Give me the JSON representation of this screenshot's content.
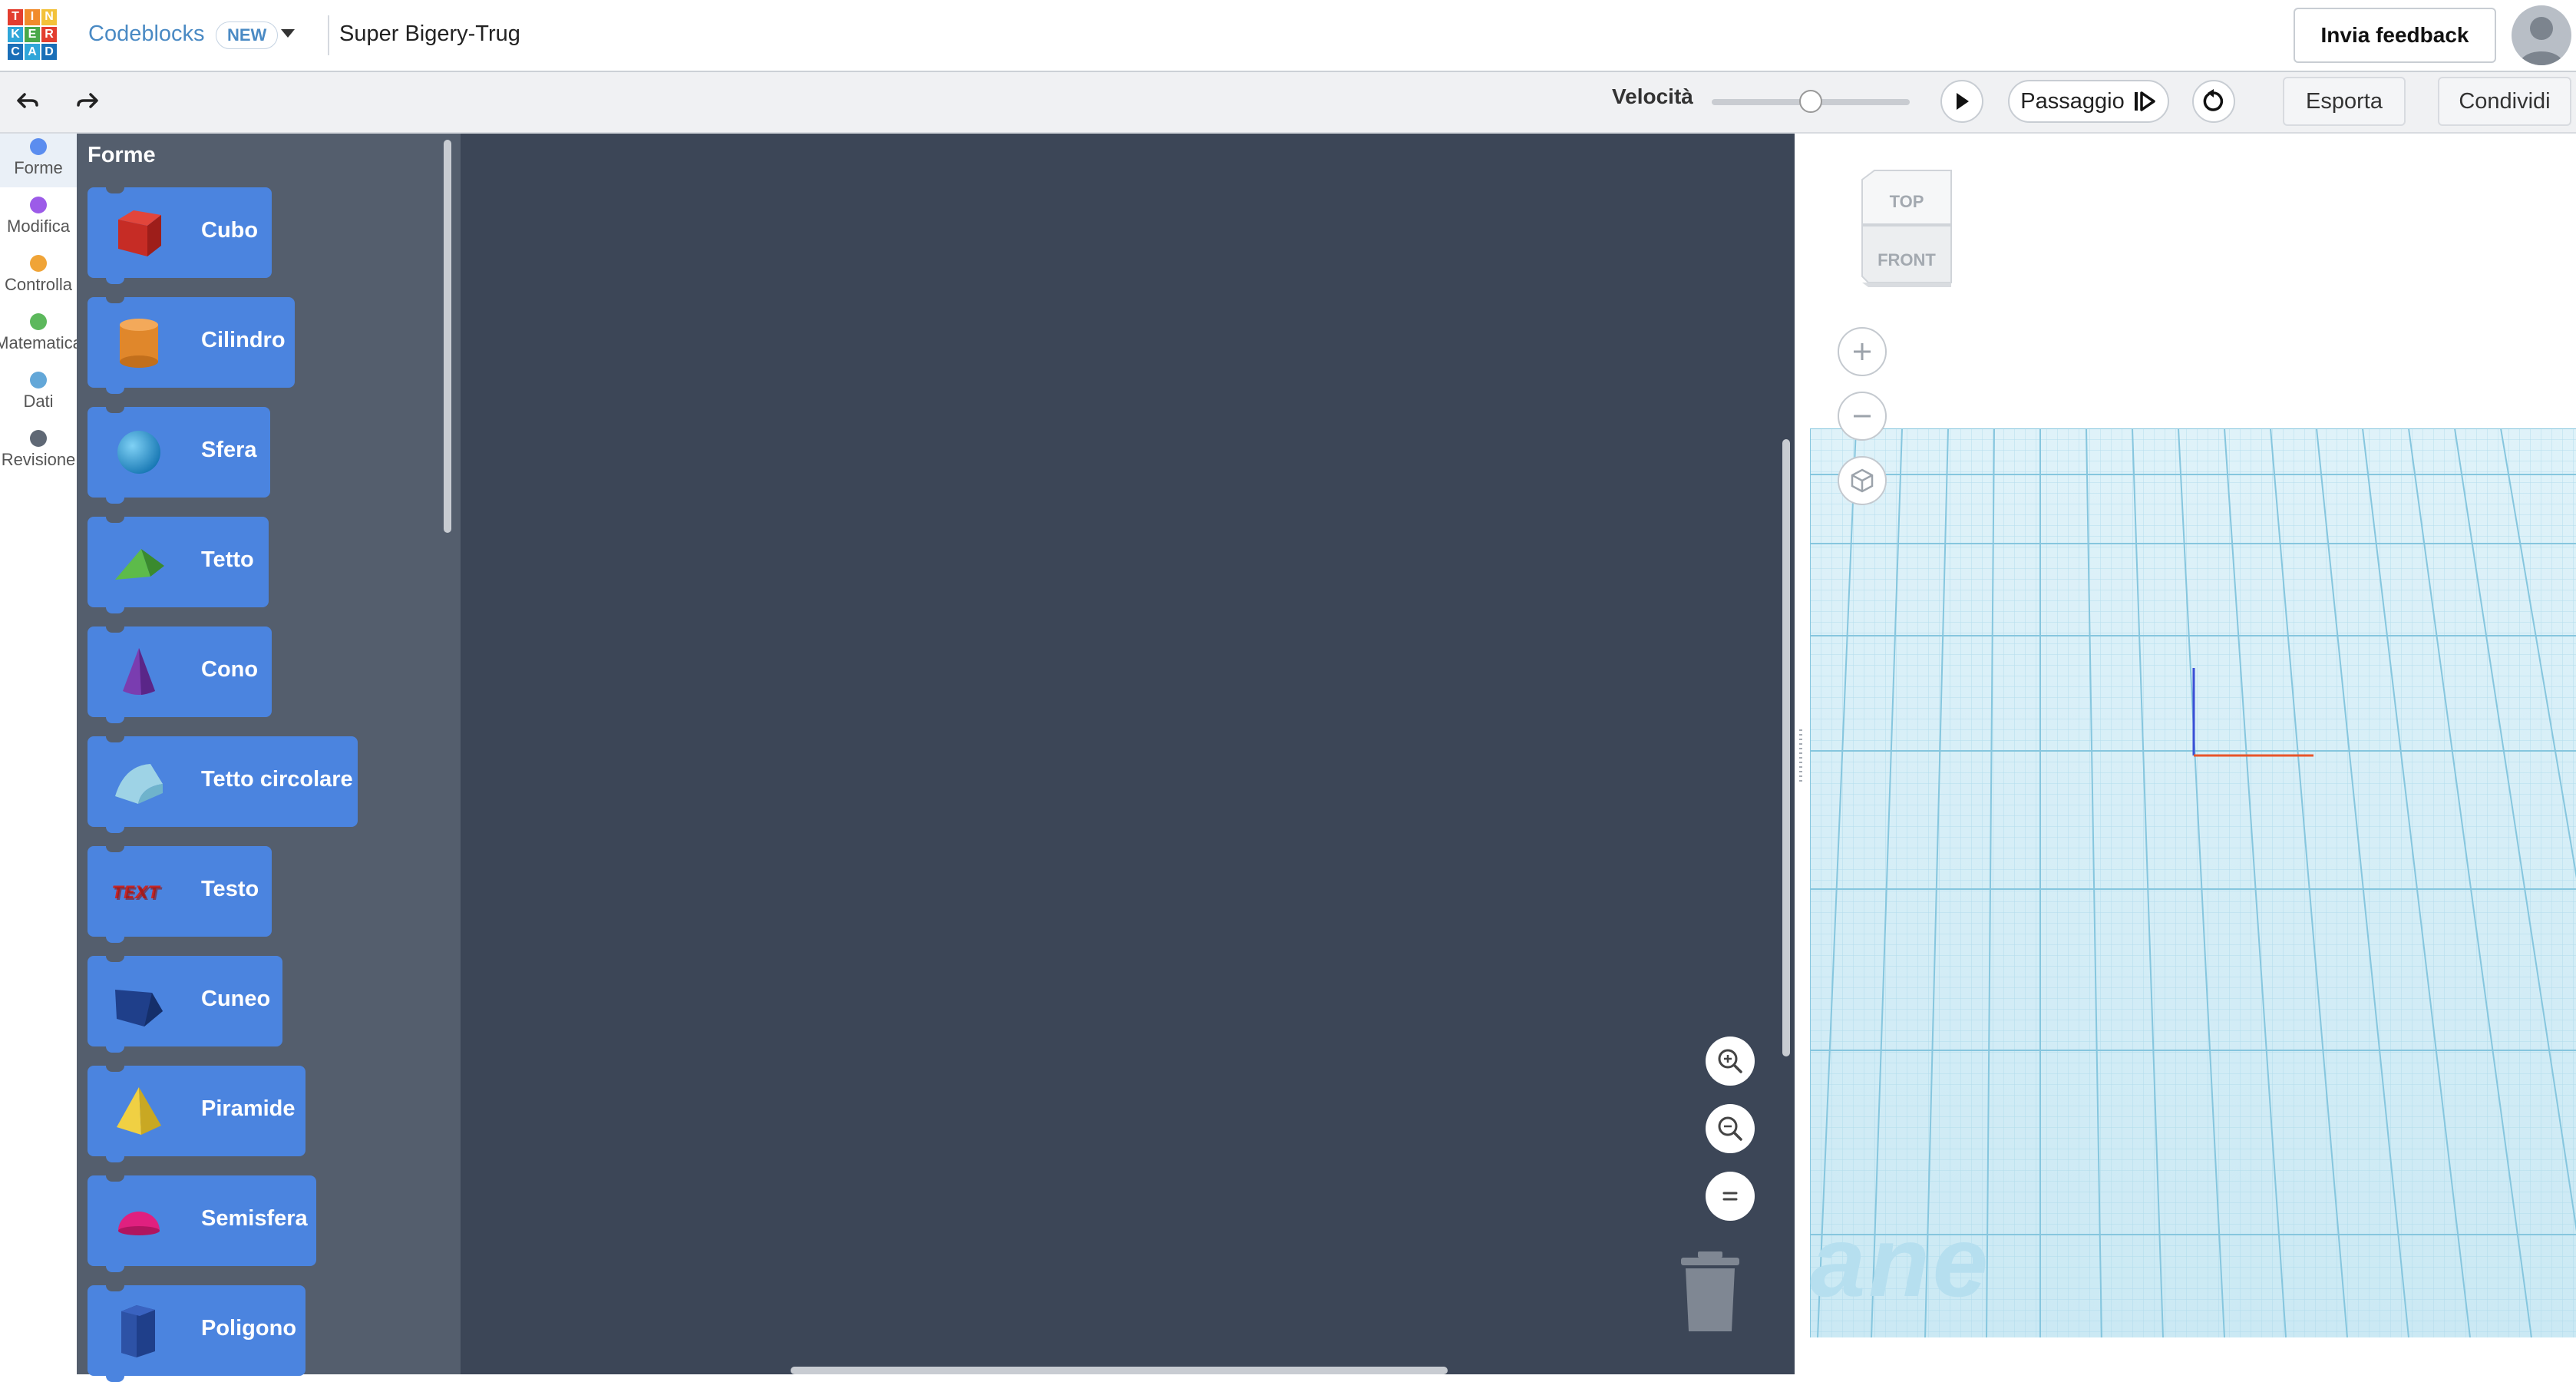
{
  "header": {
    "logo_letters": [
      "T",
      "I",
      "N",
      "K",
      "E",
      "R",
      "C",
      "A",
      "D"
    ],
    "app_name": "Codeblocks",
    "new_badge": "NEW",
    "project_title": "Super Bigery-Trug",
    "feedback_button": "Invia feedback"
  },
  "toolbar": {
    "undo_icon": "undo-arrow-icon",
    "redo_icon": "redo-arrow-icon",
    "speed_label": "Velocità",
    "speed_level": 0.5,
    "play_icon": "play-icon",
    "step_label": "Passaggio",
    "reset_icon": "reset-icon",
    "export_label": "Esporta",
    "share_label": "Condividi"
  },
  "categories": [
    {
      "label": "Forme",
      "color": "#5b8def"
    },
    {
      "label": "Modifica",
      "color": "#9c5be8"
    },
    {
      "label": "Controlla",
      "color": "#f0a437"
    },
    {
      "label": "Matematica",
      "color": "#5cb85c"
    },
    {
      "label": "Dati",
      "color": "#63a7d8"
    },
    {
      "label": "Revisione",
      "color": "#5f6875"
    }
  ],
  "flyout": {
    "title": "Forme",
    "blocks": [
      {
        "label": "Cubo",
        "icon": "cube-icon"
      },
      {
        "label": "Cilindro",
        "icon": "cylinder-icon"
      },
      {
        "label": "Sfera",
        "icon": "sphere-icon"
      },
      {
        "label": "Tetto",
        "icon": "roof-icon"
      },
      {
        "label": "Cono",
        "icon": "cone-icon"
      },
      {
        "label": "Tetto circolare",
        "icon": "round-roof-icon"
      },
      {
        "label": "Testo",
        "icon": "text-shape-icon"
      },
      {
        "label": "Cuneo",
        "icon": "wedge-icon"
      },
      {
        "label": "Piramide",
        "icon": "pyramid-icon"
      },
      {
        "label": "Semisfera",
        "icon": "half-sphere-icon"
      },
      {
        "label": "Poligono",
        "icon": "polygon-icon"
      }
    ]
  },
  "workspace": {
    "zoom_in_icon": "zoom-in-icon",
    "zoom_out_icon": "zoom-out-icon",
    "zoom_reset_icon": "zoom-reset-icon",
    "trash_icon": "trash-icon"
  },
  "viewport": {
    "viewcube_top": "TOP",
    "viewcube_front": "FRONT",
    "zoom_in_icon": "plus-icon",
    "zoom_out_icon": "minus-icon",
    "home_icon": "home-view-icon",
    "plane_watermark": "ane"
  },
  "colors": {
    "workspace_bg": "#3c4657",
    "flyout_bg": "#545e6d",
    "block_blue": "#4b84df",
    "grid_line": "#9fd1e3",
    "link_blue": "#4a8ac4"
  }
}
